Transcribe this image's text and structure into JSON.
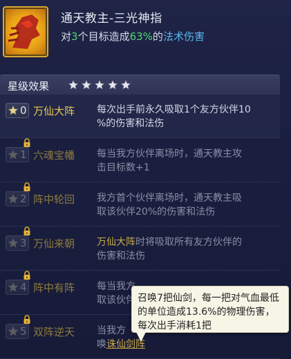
{
  "skill": {
    "title": "通天教主-三光神指",
    "desc_pre": "对",
    "desc_num": "3",
    "desc_mid": "个目标造成",
    "desc_pct": "63%",
    "desc_of": "的",
    "desc_type": "法术伤害",
    "icon": "red-fist-icon"
  },
  "star_section": {
    "title": "星级效果",
    "stars_filled": 5,
    "stars_total": 5
  },
  "rows": [
    {
      "level": "0",
      "name": "万仙大阵",
      "locked": false,
      "line1": "每次出手前永久吸取1个友方伙伴10",
      "line2": "%的伤害和法伤"
    },
    {
      "level": "1",
      "name": "六魂宝幡",
      "locked": true,
      "line1": "每当我方伙伴离场时，通天教主攻",
      "line2": "击目标数+1"
    },
    {
      "level": "2",
      "name": "阵中轮回",
      "locked": true,
      "line1": "我方首个伙伴离场时，通天教主吸",
      "line2": "取该伙伴20%的伤害和法伤"
    },
    {
      "level": "3",
      "name": "万仙来朝",
      "locked": true,
      "line1_hl": "万仙大阵",
      "line1": "时将吸取所有友方伙伴的",
      "line2": "伤害和法伤"
    },
    {
      "level": "4",
      "name": "阵中有阵",
      "locked": true,
      "line1": "每当我方",
      "line2": "取该伙伴"
    },
    {
      "level": "5",
      "name": "双阵逆天",
      "locked": true,
      "line1": "当我方",
      "line2_pre": "唤",
      "line2_link": "诛仙剑阵"
    }
  ],
  "tooltip": {
    "text": "召唤7把仙剑，每一把对气血最低的单位造成13.6%的物理伤害，每次出手消耗1把"
  },
  "colors": {
    "gold": "#e8c552",
    "green": "#52d874",
    "blue": "#56b8f0"
  }
}
